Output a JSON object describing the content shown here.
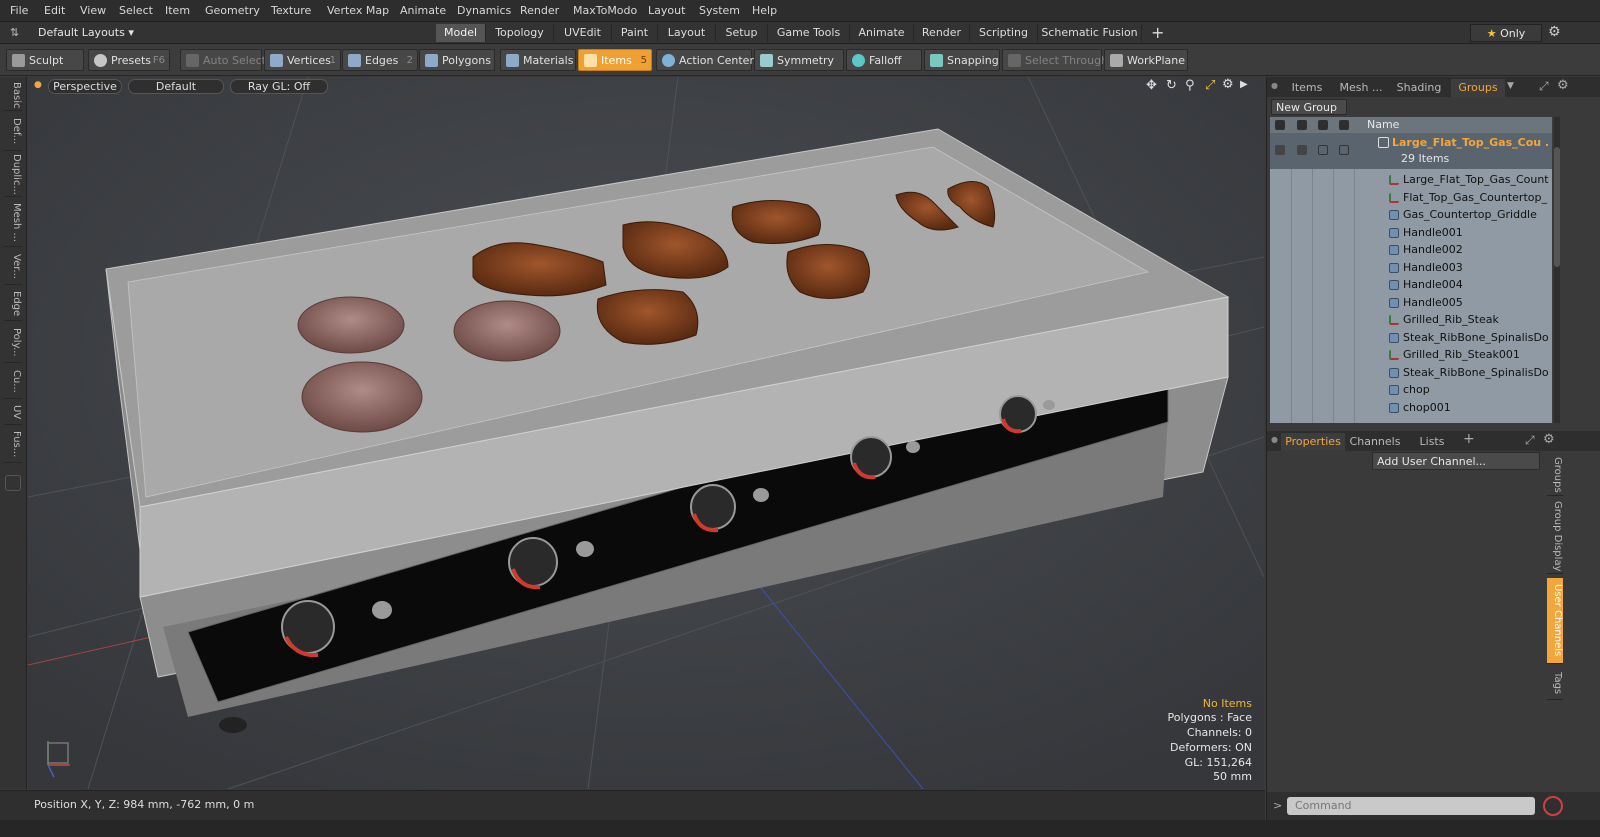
{
  "menu": [
    "File",
    "Edit",
    "View",
    "Select",
    "Item",
    "Geometry",
    "Texture",
    "Vertex Map",
    "Animate",
    "Dynamics",
    "Render",
    "MaxToModo",
    "Layout",
    "System",
    "Help"
  ],
  "layout_selector": "Default Layouts",
  "layout_tabs": [
    "Model",
    "Topology",
    "UVEdit",
    "Paint",
    "Layout",
    "Setup",
    "Game Tools",
    "Animate",
    "Render",
    "Scripting",
    "Schematic Fusion"
  ],
  "active_layout_tab": "Model",
  "only_label": "Only",
  "toolbar": {
    "sculpt": "Sculpt",
    "presets": "Presets",
    "presets_key": "F6",
    "auto_select": "Auto Select",
    "vertices": "Vertices",
    "vertices_count": "1",
    "edges": "Edges",
    "edges_count": "2",
    "polygons": "Polygons",
    "materials": "Materials",
    "items": "Items",
    "items_count": "5",
    "action_center": "Action Center",
    "symmetry": "Symmetry",
    "falloff": "Falloff",
    "snapping": "Snapping",
    "select_through": "Select Through",
    "workplane": "WorkPlane"
  },
  "left_tabs": [
    "Basic",
    "Def...",
    "Duplic...",
    "Mesh ...",
    "Ver...",
    "Edge",
    "Poly...",
    "Cu...",
    "UV",
    "Fus..."
  ],
  "viewport": {
    "view_mode": "Perspective",
    "shading": "Default",
    "raygl": "Ray GL: Off",
    "info": {
      "selection": "No Items",
      "polygons": "Polygons : Face",
      "channels": "Channels: 0",
      "deformers": "Deformers: ON",
      "gl": "GL: 151,264",
      "focal": "50 mm"
    }
  },
  "status": {
    "position": "Position X, Y, Z:  984 mm, -762 mm, 0 m"
  },
  "right_panel": {
    "tabs": [
      "Items",
      "Mesh ...",
      "Shading",
      "Groups"
    ],
    "active_tab": "Groups",
    "new_group": "New Group",
    "column_name": "Name",
    "group": {
      "name": "Large_Flat_Top_Gas_Cou ...",
      "count": "29 Items"
    },
    "items": [
      {
        "label": "Large_Flat_Top_Gas_Count ...",
        "type": "locator"
      },
      {
        "label": "Flat_Top_Gas_Countertop_ ...",
        "type": "locator"
      },
      {
        "label": "Gas_Countertop_Griddle",
        "type": "mesh"
      },
      {
        "label": "Handle001",
        "type": "mesh"
      },
      {
        "label": "Handle002",
        "type": "mesh"
      },
      {
        "label": "Handle003",
        "type": "mesh"
      },
      {
        "label": "Handle004",
        "type": "mesh"
      },
      {
        "label": "Handle005",
        "type": "mesh"
      },
      {
        "label": "Grilled_Rib_Steak",
        "type": "locator"
      },
      {
        "label": "Steak_RibBone_SpinalisDors ...",
        "type": "mesh"
      },
      {
        "label": "Grilled_Rib_Steak001",
        "type": "locator"
      },
      {
        "label": "Steak_RibBone_SpinalisDors ...",
        "type": "mesh"
      },
      {
        "label": "chop",
        "type": "mesh"
      },
      {
        "label": "chop001",
        "type": "mesh"
      }
    ],
    "prop_tabs": [
      "Properties",
      "Channels",
      "Lists"
    ],
    "active_prop_tab": "Properties",
    "add_user_channel": "Add User Channel...",
    "side_tabs": [
      "Groups",
      "Group Display",
      "User Channels",
      "Tags"
    ],
    "active_side_tab": "User Channels",
    "command_placeholder": "Command"
  },
  "colors": {
    "accent": "#f3a63c",
    "highlight_button": "#f0a030",
    "list_bg": "#8f9aa5"
  }
}
